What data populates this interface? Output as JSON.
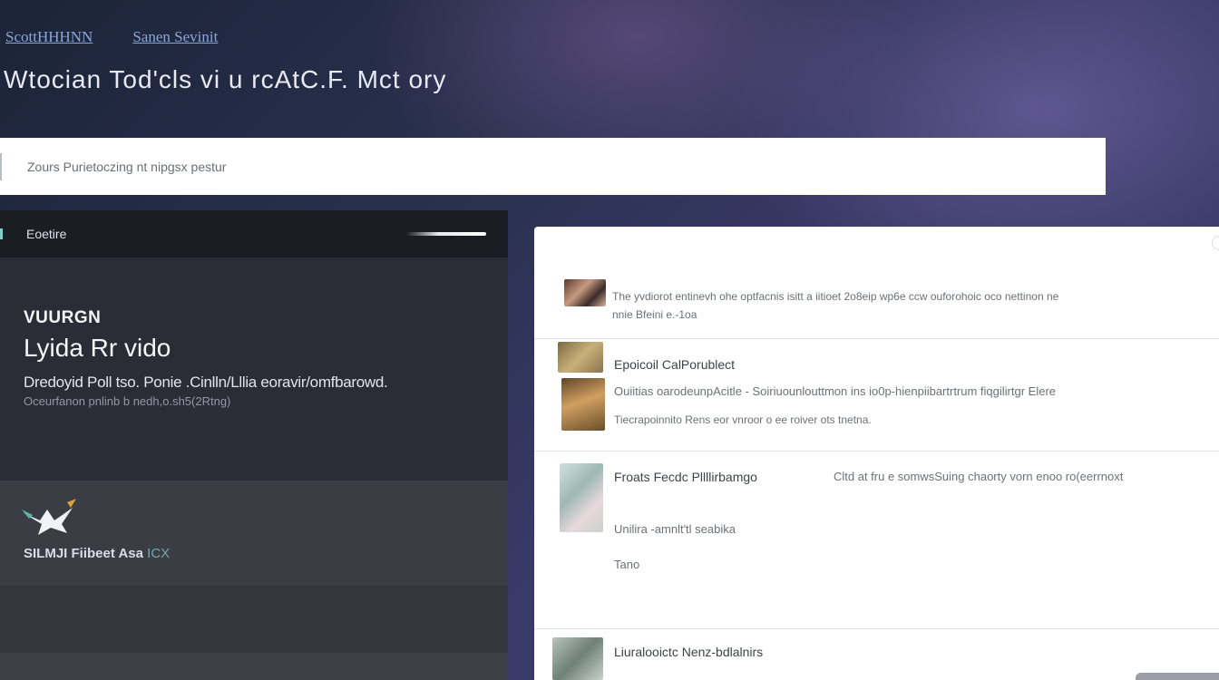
{
  "breadcrumbs": [
    "ScottHHHNN",
    "Sanen Sevinit"
  ],
  "page_title": "Wtocian Tod'cls vi u rcAtC.F. Mct ory",
  "search": {
    "placeholder": "Zours Purietoczing nt nipgsx pestur"
  },
  "left_panel": {
    "header_label": "Eoetire",
    "kicker": "VUURGN",
    "title": "Lyida Rr vido",
    "description": "Dredoyid Poll tso. Ponie .Cinlln/Lllia eoravir/omfbarowd.",
    "meta": "Oceurfanon pnlinb b nedh,o.sh5(2Rtng)",
    "brand_name": "SILMJI Fiibeet Asa",
    "brand_tag": "ICX"
  },
  "right_panel": {
    "rows": [
      {
        "lines": [
          "The yvdiorot entinevh ohe optfacnis isitt a iitioet 2o8eip wp6e ccw ouforohoic oco nettinon ne",
          "nnie Bfeini e.-1oa"
        ]
      },
      {
        "title": "Epoicoil CalPorublect",
        "lines": [
          "Ouiitias oarodeunpAcitle - Soiriuounlouttmon ins io0p-hienpiibartrtrum fiqgilirtgr Elere",
          "Tiecrapoinnito Rens eor vnroor o ee roiver ots tnetna."
        ]
      },
      {
        "title": "Froats Fecdc Pllllirbamgo",
        "aside": "Cltd at fru e somwsSuing chaorty vorn enoo ro(eerrnoxt",
        "lines": [
          "Unilira -amnlt'tl seabika",
          "Tano"
        ]
      },
      {
        "title": "Liuralooictc Nenz-bdlalnirs"
      }
    ]
  }
}
